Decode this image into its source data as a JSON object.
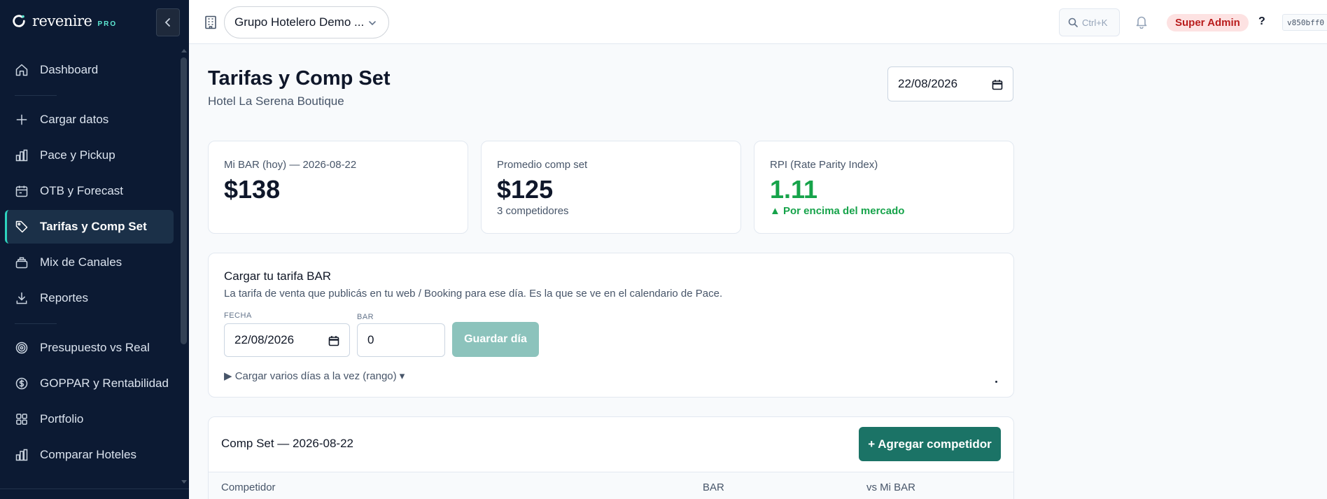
{
  "brand": {
    "name": "revenire",
    "tier": "PRO"
  },
  "sidebar": {
    "items": [
      {
        "label": "Dashboard",
        "icon": "home-icon"
      },
      {
        "label": "Cargar datos",
        "icon": "plus-icon"
      },
      {
        "label": "Pace y Pickup",
        "icon": "bar-chart-icon"
      },
      {
        "label": "OTB y Forecast",
        "icon": "calendar-icon"
      },
      {
        "label": "Tarifas y Comp Set",
        "icon": "tag-icon",
        "active": true
      },
      {
        "label": "Mix de Canales",
        "icon": "layers-icon"
      },
      {
        "label": "Reportes",
        "icon": "download-icon"
      },
      {
        "label": "Presupuesto vs Real",
        "icon": "target-icon"
      },
      {
        "label": "GOPPAR y Rentabilidad",
        "icon": "dollar-circle-icon"
      },
      {
        "label": "Portfolio",
        "icon": "grid-icon"
      },
      {
        "label": "Comparar Hoteles",
        "icon": "bar-chart-icon"
      }
    ]
  },
  "topbar": {
    "org": "Grupo Hotelero Demo ...",
    "search_shortcut": "Ctrl+K",
    "role": "Super Admin",
    "help": "?",
    "version": "v850bff0"
  },
  "page": {
    "title": "Tarifas y Comp Set",
    "subtitle": "Hotel La Serena Boutique",
    "date": "22/08/2026"
  },
  "kpis": [
    {
      "label": "Mi BAR (hoy) — 2026-08-22",
      "value": "$138",
      "sub": ""
    },
    {
      "label": "Promedio comp set",
      "value": "$125",
      "sub": "3 competidores"
    },
    {
      "label": "RPI (Rate Parity Index)",
      "value": "1.11",
      "sub": "▲ Por encima del mercado"
    }
  ],
  "bar_form": {
    "title": "Cargar tu tarifa BAR",
    "description": "La tarifa de venta que publicás en tu web / Booking para ese día. Es la que se ve en el calendario de Pace.",
    "date_label": "FECHA",
    "date_value": "22/08/2026",
    "bar_label": "BAR",
    "bar_value": "0",
    "save_label": "Guardar día",
    "range_toggle": "▶ Cargar varios días a la vez (rango) ▾"
  },
  "compset": {
    "title": "Comp Set — 2026-08-22",
    "add_label": "+ Agregar competidor",
    "columns": [
      "Competidor",
      "BAR",
      "vs Mi BAR"
    ]
  },
  "colors": {
    "sidebar_bg": "#0c1a33",
    "accent": "#2dd4bf",
    "primary_button": "#1b7366",
    "positive": "#16a34a",
    "badge_bg": "#fde2e2"
  }
}
